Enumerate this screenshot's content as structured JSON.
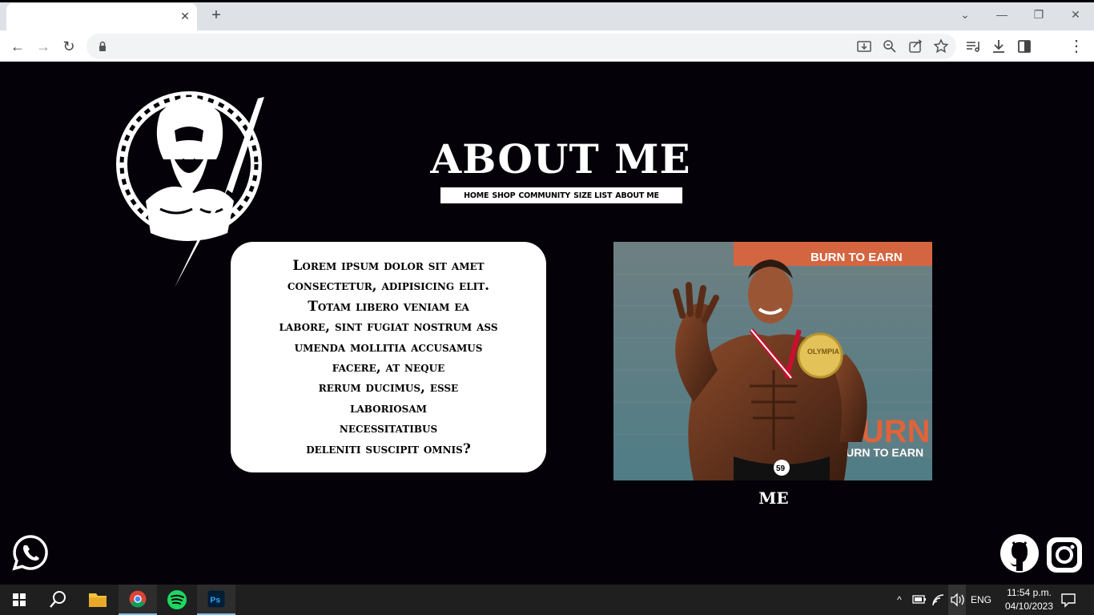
{
  "browser": {
    "tab_title": "",
    "tab_close": "✕",
    "new_tab": "+",
    "address_value": "",
    "back": "←",
    "forward": "→",
    "reload": "↻",
    "minimize": "—",
    "restore": "❐",
    "close": "✕",
    "tab_search": "⌄",
    "menu": "⋮"
  },
  "page": {
    "title": "ABOUT ME",
    "nav": [
      "HOME",
      "SHOP",
      "COMMUNITY",
      "SIZE LIST",
      "ABOUT ME"
    ],
    "paragraph_lines": [
      "Lorem ipsum dolor sit amet",
      "consectetur, adipisicing elit.",
      "Totam libero veniam ea",
      "labore, sint fugiat nostrum ass",
      "umenda mollitia accusamus",
      "facere, at neque",
      "rerum ducimus, esse",
      "laboriosam",
      "necessitatibus",
      "deleniti suscipit omnis?"
    ],
    "photo_caption": "ME",
    "photo_text_top": "BURN TO EARN",
    "photo_text_bottom": "BURN",
    "photo_text_bottom2": "BURN TO EARN",
    "medal_text": "OLYMPIA",
    "bib_number": "59"
  },
  "taskbar": {
    "lang": "ENG",
    "time": "11:54 p.m.",
    "date": "04/10/2023"
  },
  "colors": {
    "page_bg": "#050108",
    "chrome_bg": "#dee1e6",
    "taskbar_bg": "#1f1f1f",
    "spotify": "#1ed760",
    "photoshop": "#31a8ff"
  }
}
